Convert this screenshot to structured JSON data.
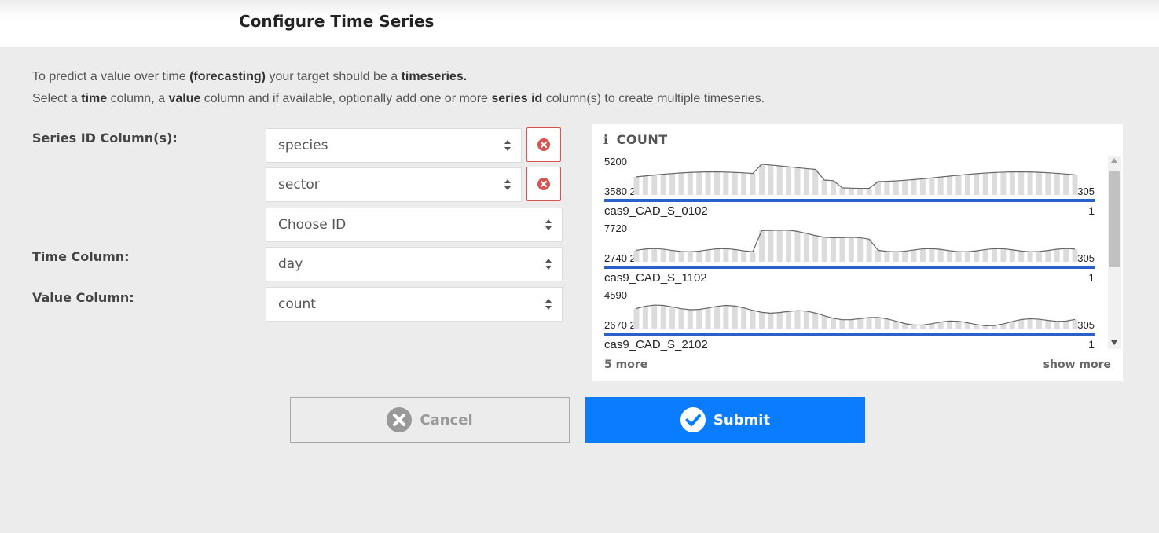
{
  "header": {
    "title": "Configure Time Series"
  },
  "intro": {
    "line1": {
      "a": "To predict a value over time ",
      "b": "(forecasting)",
      "c": " your target should be a ",
      "d": "timeseries."
    },
    "line2": {
      "a": "Select a ",
      "b": "time",
      "c": " column, a ",
      "d": "value",
      "e": " column and if available, optionally add one or more ",
      "f": "series id",
      "g": " column(s) to create multiple timeseries."
    }
  },
  "form": {
    "series_id_label": "Series ID Column(s):",
    "series_ids": [
      "species",
      "sector"
    ],
    "choose_id_placeholder": "Choose ID",
    "time_label": "Time Column:",
    "time_value": "day",
    "value_label": "Value Column:",
    "value_value": "count"
  },
  "preview": {
    "title": "COUNT",
    "series": [
      {
        "name": "cas9_CAD_S_0102",
        "max": "5200",
        "min": "3580",
        "start": "2",
        "end": "305",
        "count": "1"
      },
      {
        "name": "cas9_CAD_S_1102",
        "max": "7720",
        "min": "2740",
        "start": "2",
        "end": "305",
        "count": "1"
      },
      {
        "name": "cas9_CAD_S_2102",
        "max": "4590",
        "min": "2670",
        "start": "2",
        "end": "305",
        "count": "1"
      }
    ],
    "more_count": "5 more",
    "show_more": "show more"
  },
  "buttons": {
    "cancel": "Cancel",
    "submit": "Submit"
  },
  "colors": {
    "accent": "#0a7cff",
    "danger": "#d9534f",
    "series_bar": "#2b5fcc"
  }
}
